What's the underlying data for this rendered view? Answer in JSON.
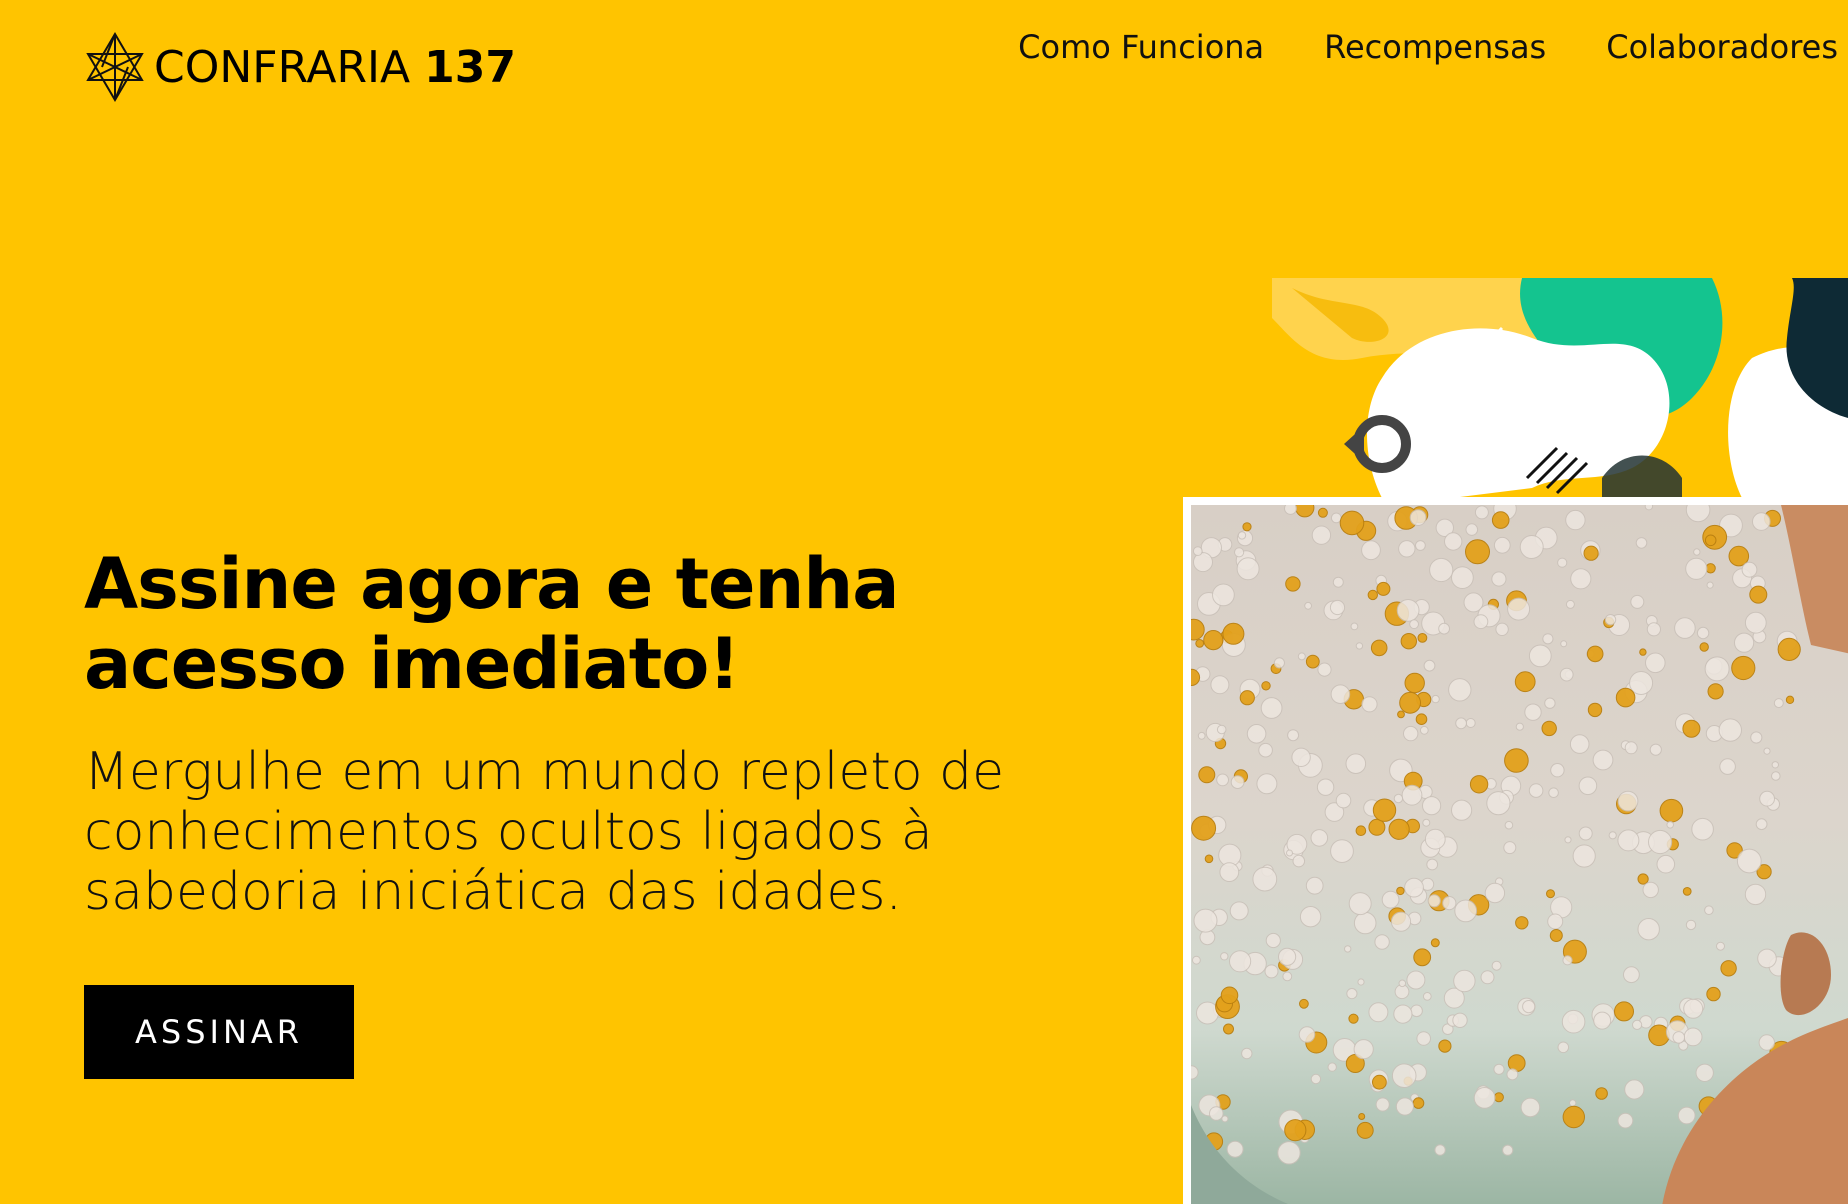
{
  "header": {
    "logo_text": "CONFRARIA",
    "logo_number": "137",
    "logo_icon": "star-tetrahedron-icon",
    "nav": [
      {
        "label": "Como Funciona"
      },
      {
        "label": "Recompensas"
      },
      {
        "label": "Colaboradores"
      }
    ]
  },
  "hero": {
    "headline_line1": "Assine agora e tenha",
    "headline_line2": "acesso imediato!",
    "subtext_line1": "Mergulhe em um mundo repleto de",
    "subtext_line2": "conhecimentos ocultos ligados à",
    "subtext_line3": "sabedoria iniciática das idades.",
    "cta_label": "ASSINAR"
  },
  "colors": {
    "background": "#FFC400",
    "cta_background": "#000000",
    "cta_text": "#FFFFFF",
    "accent_green": "#14C48F",
    "accent_navy": "#0E2A35"
  }
}
